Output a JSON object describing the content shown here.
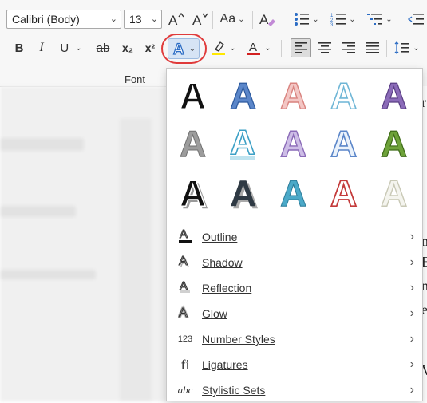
{
  "ribbon": {
    "font_name": "Calibri (Body)",
    "font_size": "13",
    "grow_font_glyph": "A^",
    "shrink_font_glyph": "Aˇ",
    "change_case_glyph": "Aa",
    "bold": "B",
    "italic": "I",
    "underline": "U",
    "strikethrough": "ab",
    "subscript": "x₂",
    "superscript": "x²",
    "font_group_label": "Font",
    "highlight_color": "#ffe800",
    "font_color": "#d32020"
  },
  "text_effects_menu": {
    "items": [
      {
        "label": "Outline",
        "icon": "outline-icon"
      },
      {
        "label": "Shadow",
        "icon": "shadow-icon"
      },
      {
        "label": "Reflection",
        "icon": "reflection-icon"
      },
      {
        "label": "Glow",
        "icon": "glow-icon"
      },
      {
        "label": "Number Styles",
        "icon": "number-styles-icon",
        "glyph": "123"
      },
      {
        "label": "Ligatures",
        "icon": "ligatures-icon",
        "glyph": "fi"
      },
      {
        "label": "Stylistic Sets",
        "icon": "stylistic-sets-icon",
        "glyph": "abc"
      }
    ],
    "gallery_letter": "A"
  },
  "document": {
    "visible_fragments": [
      "r",
      "n",
      "E",
      "n",
      "e",
      "V"
    ]
  }
}
